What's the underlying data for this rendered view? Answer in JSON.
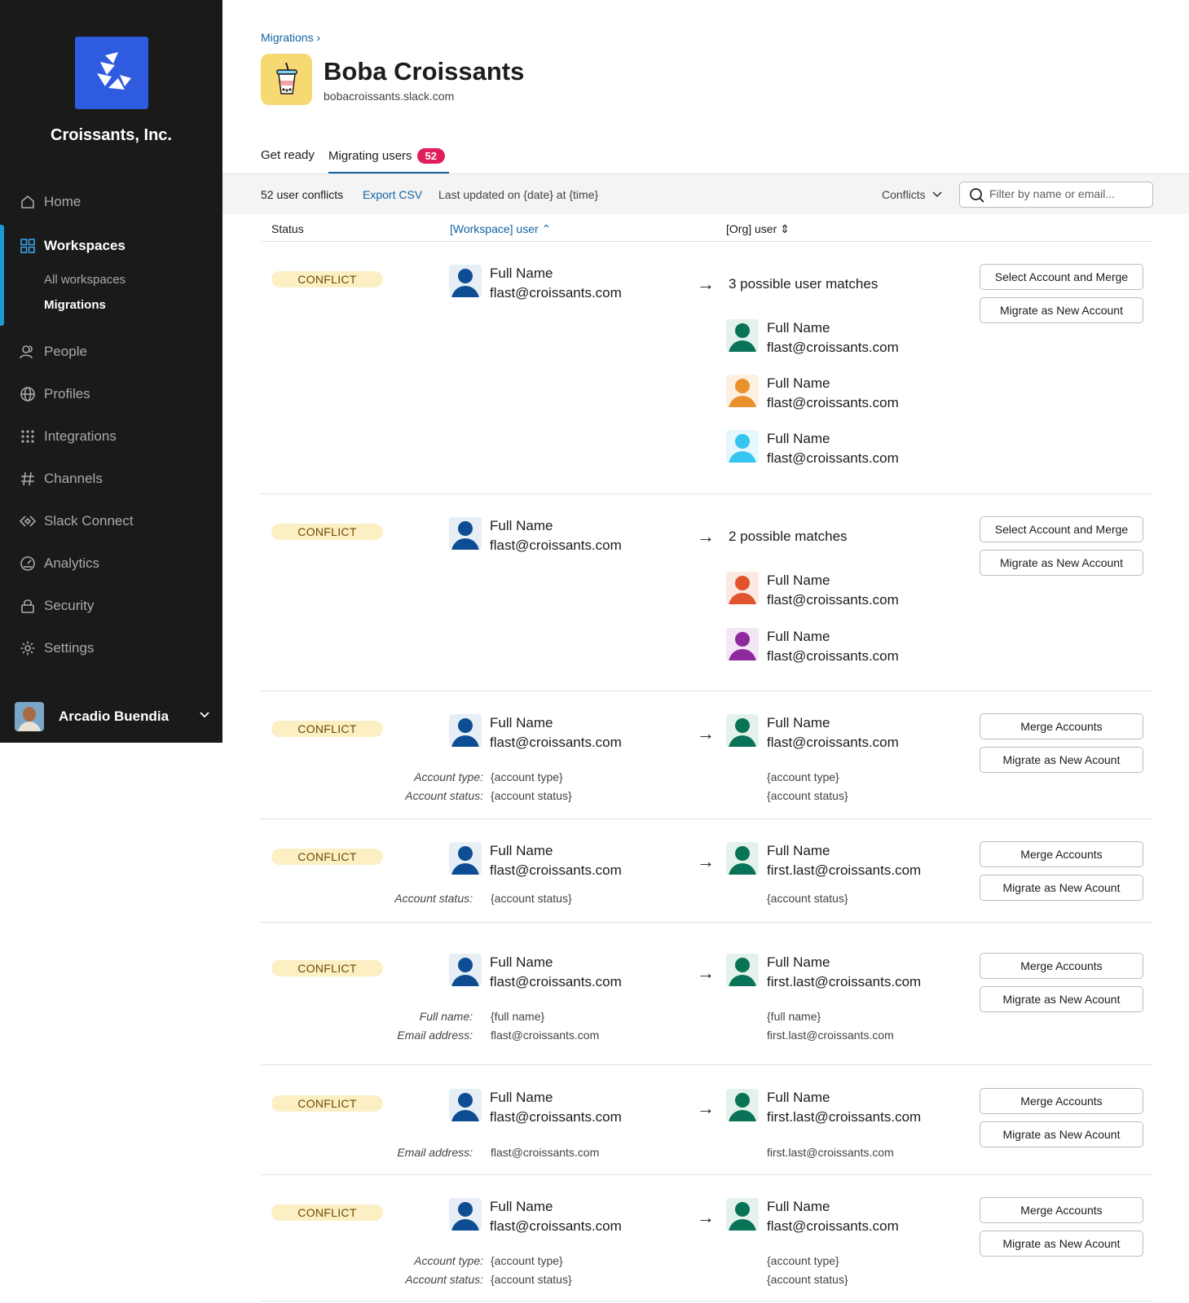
{
  "sidebar": {
    "org_name": "Croissants, Inc.",
    "nav": {
      "home": "Home",
      "workspaces": "Workspaces",
      "all_workspaces": "All workspaces",
      "migrations": "Migrations",
      "people": "People",
      "profiles": "Profiles",
      "integrations": "Integrations",
      "channels": "Channels",
      "slack_connect": "Slack Connect",
      "analytics": "Analytics",
      "security": "Security",
      "settings": "Settings"
    },
    "user_name": "Arcadio Buendia"
  },
  "header": {
    "breadcrumb": "Migrations ›",
    "title": "Boba Croissants",
    "domain": "bobacroissants.slack.com",
    "tabs": {
      "get_ready": "Get ready",
      "migrating_users": "Migrating users",
      "migrating_count": "52"
    }
  },
  "toolbar": {
    "count": "52 user conflicts",
    "export": "Export CSV",
    "updated": "Last updated on {date} at {time}",
    "conflicts_filter": "Conflicts",
    "search_placeholder": "Filter by name or email..."
  },
  "columns": {
    "status": "Status",
    "workspace_user": "[Workspace] user ⌃",
    "org_user": "[Org] user ⇕"
  },
  "common": {
    "conflict": "CONFLICT",
    "full_name": "Full Name",
    "flast_email": "flast@croissants.com",
    "firstlast_email": "first.last@croissants.com",
    "select_merge": "Select Account and Merge",
    "migrate_new": "Migrate as New Account",
    "merge_accounts": "Merge Accounts",
    "migrate_new_acount": "Migrate as New Acount",
    "account_type_label": "Account type:",
    "account_status_label": "Account status:",
    "full_name_label": "Full name:",
    "email_label": "Email address:",
    "account_type_val": "{account type}",
    "account_status_val": "{account status}",
    "full_name_val": "{full name}"
  },
  "rows": {
    "r1": {
      "matches": "3 possible user matches"
    },
    "r2": {
      "matches": "2 possible matches"
    }
  },
  "colors": {
    "accent": "#1264a3",
    "badge_bg": "#fcefc4",
    "tab_badge": "#e01e5a",
    "workspace_avatar": "#0e4d93",
    "match_green": "#087356",
    "match_orange": "#e8912d",
    "match_cyan": "#36c5f0",
    "match_red": "#e0542e",
    "match_purple": "#8e2a9e"
  }
}
